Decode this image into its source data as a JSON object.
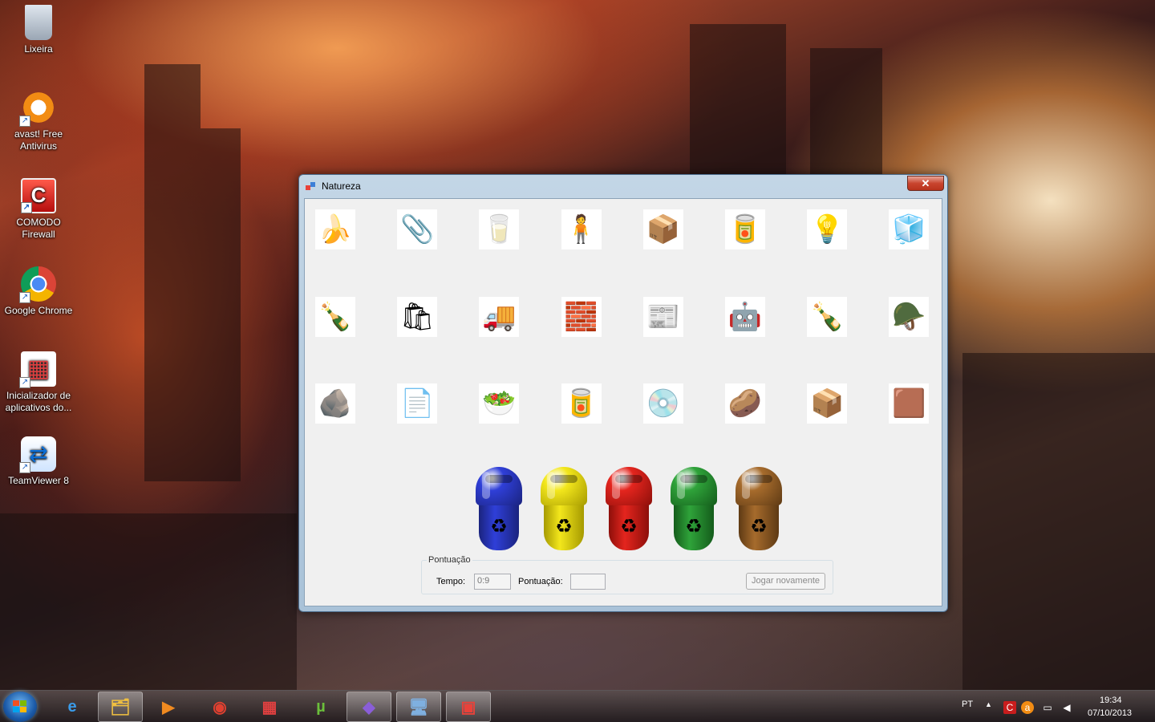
{
  "desktop": {
    "icons": [
      {
        "label": "Lixeira",
        "icon": "recycle-bin-icon"
      },
      {
        "label": "avast! Free Antivirus",
        "icon": "avast-icon"
      },
      {
        "label": "COMODO Firewall",
        "icon": "comodo-icon"
      },
      {
        "label": "Google Chrome",
        "icon": "chrome-icon"
      },
      {
        "label": "Inicializador de aplicativos do...",
        "icon": "app-launcher-icon"
      },
      {
        "label": "TeamViewer 8",
        "icon": "teamviewer-icon"
      }
    ]
  },
  "window": {
    "title": "Natureza",
    "close_label": "✕",
    "items": [
      {
        "name": "banana-peel",
        "glyph": "🍌"
      },
      {
        "name": "paper-clips",
        "glyph": "📎"
      },
      {
        "name": "glass-cup",
        "glyph": "🥛"
      },
      {
        "name": "green-mascot",
        "glyph": "🧍"
      },
      {
        "name": "cardboard",
        "glyph": "📦"
      },
      {
        "name": "metal-cans",
        "glyph": "🥫"
      },
      {
        "name": "light-bulb",
        "glyph": "💡"
      },
      {
        "name": "broken-glass",
        "glyph": "🧊"
      },
      {
        "name": "green-bottle",
        "glyph": "🍾"
      },
      {
        "name": "snack-bag",
        "glyph": "🛍"
      },
      {
        "name": "toy-truck",
        "glyph": "🚚"
      },
      {
        "name": "lego-bricks",
        "glyph": "🧱"
      },
      {
        "name": "newspaper",
        "glyph": "📰"
      },
      {
        "name": "robot-toy",
        "glyph": "🤖"
      },
      {
        "name": "green-bottle-2",
        "glyph": "🍾"
      },
      {
        "name": "plastic-soldiers",
        "glyph": "🪖"
      },
      {
        "name": "crumpled-foil",
        "glyph": "🪨"
      },
      {
        "name": "notebook-paper",
        "glyph": "📄"
      },
      {
        "name": "food-scraps",
        "glyph": "🥗"
      },
      {
        "name": "blue-can",
        "glyph": "🥫"
      },
      {
        "name": "cd-disc",
        "glyph": "💿"
      },
      {
        "name": "pou-character",
        "glyph": "🥔"
      },
      {
        "name": "corrugated-cardboard",
        "glyph": "📦"
      },
      {
        "name": "soil-compost",
        "glyph": "🟫"
      }
    ],
    "bins": [
      {
        "name": "blue-bin",
        "color": "#2f3fd8",
        "dark": "#1a237e"
      },
      {
        "name": "yellow-bin",
        "color": "#f3e71c",
        "dark": "#a69a00"
      },
      {
        "name": "red-bin",
        "color": "#e4251e",
        "dark": "#8d0f0a"
      },
      {
        "name": "green-bin",
        "color": "#2fa33a",
        "dark": "#145c1b"
      },
      {
        "name": "brown-bin",
        "color": "#a66b2c",
        "dark": "#5e3a14"
      }
    ],
    "score_group": {
      "legend": "Pontuação",
      "time_label": "Tempo:",
      "time_value": "0:9",
      "score_label": "Pontuação:",
      "score_value": "",
      "play_again": "Jogar novamente"
    }
  },
  "taskbar": {
    "buttons": [
      {
        "name": "internet-explorer-icon",
        "glyph": "e",
        "color": "#3a9be8"
      },
      {
        "name": "file-explorer-icon",
        "glyph": "🗂",
        "color": "#f0c040"
      },
      {
        "name": "media-player-icon",
        "glyph": "▶",
        "color": "#f08a20"
      },
      {
        "name": "chrome-icon",
        "glyph": "◉",
        "color": "#e04030"
      },
      {
        "name": "app-launcher-icon",
        "glyph": "▦",
        "color": "#e04040"
      },
      {
        "name": "utorrent-icon",
        "glyph": "µ",
        "color": "#6bbf3b"
      },
      {
        "name": "visual-studio-icon",
        "glyph": "◆",
        "color": "#8a5ed8"
      },
      {
        "name": "remote-desktop-icon",
        "glyph": "🖥",
        "color": "#7fb0e0"
      },
      {
        "name": "natureza-app-icon",
        "glyph": "▣",
        "color": "#e8423a"
      }
    ],
    "language": "PT",
    "time": "19:34",
    "date": "07/10/2013"
  }
}
